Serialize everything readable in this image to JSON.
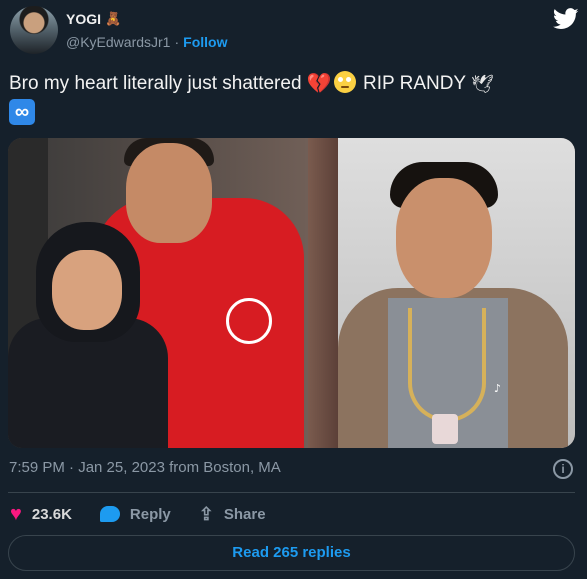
{
  "author": {
    "display_name": "YOGI",
    "display_name_emoji": "🧸",
    "handle": "@KyEdwardsJr1",
    "separator": "·",
    "follow_label": "Follow"
  },
  "tweet": {
    "text_part1": "Bro my heart literally just shattered",
    "text_part2": "RIP RANDY",
    "broken_heart_glyph": "💔",
    "dove_glyph": "🕊",
    "infinity_glyph": "∞"
  },
  "media": {
    "tiktok_label": "♪"
  },
  "meta": {
    "timestamp": "7:59 PM · Jan 25, 2023 from Boston, MA",
    "info_glyph": "i"
  },
  "actions": {
    "like_count": "23.6K",
    "reply_label": "Reply",
    "share_label": "Share",
    "share_glyph": "⇪",
    "heart_glyph": "♥"
  },
  "read_replies_label": "Read 265 replies",
  "colors": {
    "background": "#15202b",
    "accent": "#1d9bf0",
    "like": "#f91880",
    "muted": "#8b98a5"
  }
}
